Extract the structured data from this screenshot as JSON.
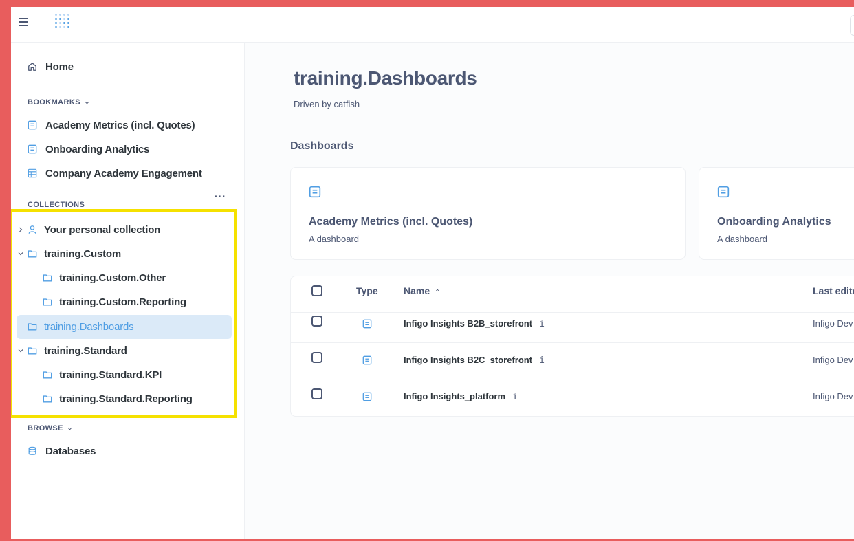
{
  "sidebar": {
    "home": "Home",
    "bookmarks_label": "BOOKMARKS",
    "bookmarks": [
      "Academy Metrics (incl. Quotes)",
      "Onboarding Analytics",
      "Company Academy Engagement"
    ],
    "collections_label": "COLLECTIONS",
    "collections_more": "···",
    "collections": [
      "Your personal collection",
      "training.Custom",
      "training.Custom.Other",
      "training.Custom.Reporting",
      "training.Dashboards",
      "training.Standard",
      "training.Standard.KPI",
      "training.Standard.Reporting"
    ],
    "browse_label": "BROWSE",
    "browse": [
      "Databases"
    ]
  },
  "main": {
    "title": "training.Dashboards",
    "subtitle": "Driven by catfish",
    "dashboards_heading": "Dashboards",
    "cards": [
      {
        "title": "Academy Metrics (incl. Quotes)",
        "subtitle": "A dashboard"
      },
      {
        "title": "Onboarding Analytics",
        "subtitle": "A dashboard"
      }
    ],
    "table": {
      "headers": {
        "type": "Type",
        "name": "Name",
        "sort_icon": "⌃",
        "last": "Last edite"
      },
      "rows": [
        {
          "name": "Infigo Insights B2B_storefront",
          "info": "i",
          "last": "Infigo Dev"
        },
        {
          "name": "Infigo Insights B2C_storefront",
          "info": "i",
          "last": "Infigo Dev"
        },
        {
          "name": "Infigo Insights_platform",
          "info": "i",
          "last": "Infigo Dev"
        }
      ]
    }
  },
  "colors": {
    "accent": "#509ee3",
    "active_bg": "#dbeaf8",
    "highlight": "#f5e100",
    "frame": "#e85d5d"
  }
}
